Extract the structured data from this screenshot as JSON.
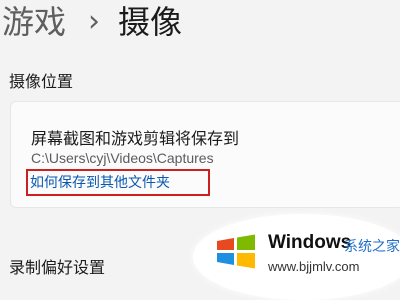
{
  "breadcrumb": {
    "parent": "游戏",
    "separator": "›",
    "current": "摄像"
  },
  "capture_location": {
    "section_title": "摄像位置",
    "card": {
      "title": "屏幕截图和游戏剪辑将保存到",
      "path": "C:\\Users\\cyj\\Videos\\Captures",
      "link": "如何保存到其他文件夹"
    }
  },
  "recording": {
    "section_title": "录制偏好设置"
  },
  "watermark": {
    "brand": "Windows",
    "brand_cn": "系统之家",
    "url": "www.bjjmlv.com"
  },
  "colors": {
    "link": "#0a58b2",
    "highlight_box": "#cc1f1f",
    "logo": [
      "#e84a1f",
      "#7fba00",
      "#1f8fe0",
      "#ffb900"
    ]
  }
}
